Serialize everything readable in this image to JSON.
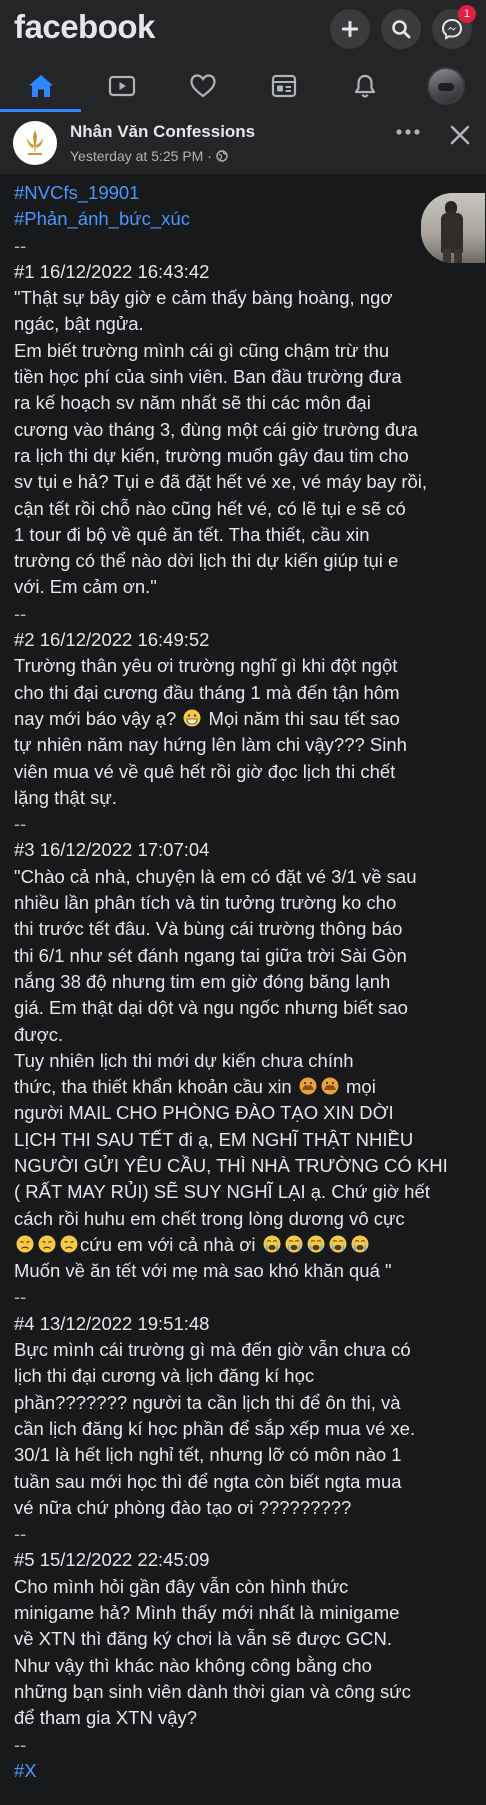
{
  "app": {
    "logo_text": "facebook"
  },
  "header_actions": {
    "create_icon": "plus-icon",
    "search_icon": "search-icon",
    "messenger_icon": "messenger-icon",
    "messenger_badge": "1"
  },
  "nav_tabs": [
    {
      "icon": "home-icon",
      "active": true
    },
    {
      "icon": "video-icon",
      "active": false
    },
    {
      "icon": "dating-heart-icon",
      "active": false
    },
    {
      "icon": "news-icon",
      "active": false
    },
    {
      "icon": "bell-icon",
      "active": false
    },
    {
      "icon": "profile-avatar-icon",
      "active": false
    }
  ],
  "post": {
    "page_name": "Nhân Văn Confessions",
    "time": "Yesterday at 5:25 PM · ",
    "privacy_icon": "globe-icon",
    "more_icon": "more-dots-icon",
    "close_icon": "close-icon",
    "accent_color": "#4599ff",
    "lines": [
      "#NVCfs_19901",
      "#Phản_ánh_bức_xúc",
      "--",
      "#1 16/12/2022 16:43:42",
      "\"Thật sự bây giờ e cảm thấy bàng hoàng, ngơ",
      "ngác, bật ngửa.",
      "Em biết trường mình cái gì cũng chậm trừ thu",
      "tiền học phí của sinh viên. Ban đầu trường đưa",
      "ra kế hoạch sv năm nhất sẽ thi các môn đại",
      "cương vào tháng 3, đùng một cái giờ trường đưa",
      "ra lịch thi dự kiến, trường muốn gây đau tim cho",
      "sv tụi e hả? Tụi e đã đặt hết vé xe, vé máy bay rồi,",
      "cận tết rồi chỗ nào cũng hết vé, có lẽ tụi e sẽ có",
      "1 tour đi bộ về quê ăn tết. Tha thiết, cầu xin",
      "trường có thể nào dời lịch thi dự kiến giúp tụi e",
      "với. Em cảm ơn.\"",
      "--",
      "#2 16/12/2022 16:49:52",
      "Trường thân yêu ơi trường nghĩ gì khi đột ngột",
      "cho thi đại cương đầu tháng 1 mà đến tận hôm",
      "nay mới báo vậy ạ? [grin] Mọi năm thi sau tết sao",
      "tự nhiên năm nay hứng lên làm chi vậy??? Sinh",
      "viên mua vé về quê hết rồi giờ đọc lịch thi chết",
      "lặng thật sự.",
      "--",
      "#3 16/12/2022 17:07:04",
      "\"Chào cả nhà, chuyện là em có đặt vé 3/1 về sau",
      "nhiều lần phân tích và tin tưởng trường ko cho",
      "thi trước tết đâu. Và bùng cái trường thông báo",
      "thi 6/1 như sét đánh ngang tai giữa trời Sài Gòn",
      "nắng 38 độ nhưng tim em giờ đóng băng lạnh",
      "giá. Em thật dại dột và ngu ngốc nhưng biết sao",
      "được.",
      "    Tuy nhiên lịch thi mới dự kiến chưa chính",
      "thức, tha thiết khẩn khoản cầu xin [pray][pray] mọi",
      "người MAIL CHO PHÒNG ĐÀO TẠO XIN DỜI",
      "LỊCH THI SAU TẾT đi ạ, EM NGHĨ THẬT NHIỀU",
      "NGƯỜI GỬI YÊU CẦU, THÌ NHÀ TRƯỜNG CÓ KHI",
      "( RẤT MAY RỦI) SẼ SUY NGHĨ LẠI ạ. Chứ giờ hết",
      "cách rồi huhu em chết trong lòng dương vô cực",
      "[sad][sad][sad]cứu em với cả nhà ơi [cry][cry][cry][cry][cry]",
      "Muốn về ăn tết với mẹ mà sao khó khăn quá \"",
      "--",
      "#4 13/12/2022 19:51:48",
      "Bực mình cái trường gì mà đến giờ vẫn chưa có",
      "lịch thi đại cương và lịch đăng kí học",
      "phần??????? người ta cần lịch thi để ôn thi, và",
      "cần lịch đăng kí học phần để sắp xếp mua vé xe.",
      "30/1 là hết lịch nghỉ tết, nhưng lỡ có môn nào 1",
      "tuần sau mới học thì để ngta còn biết ngta mua",
      "vé nữa chứ phòng đào tạo ơi ?????????",
      "--",
      "#5 15/12/2022 22:45:09",
      "Cho mình hỏi gần đây vẫn còn hình thức",
      "minigame hả? Mình thấy mới nhất là minigame",
      "về XTN thì đăng ký chơi là vẫn sẽ được GCN.",
      "Như vậy thì khác nào không công bằng cho",
      "những bạn sinh viên dành thời gian và công sức",
      "để tham gia XTN vậy?",
      "--",
      "#X"
    ]
  }
}
